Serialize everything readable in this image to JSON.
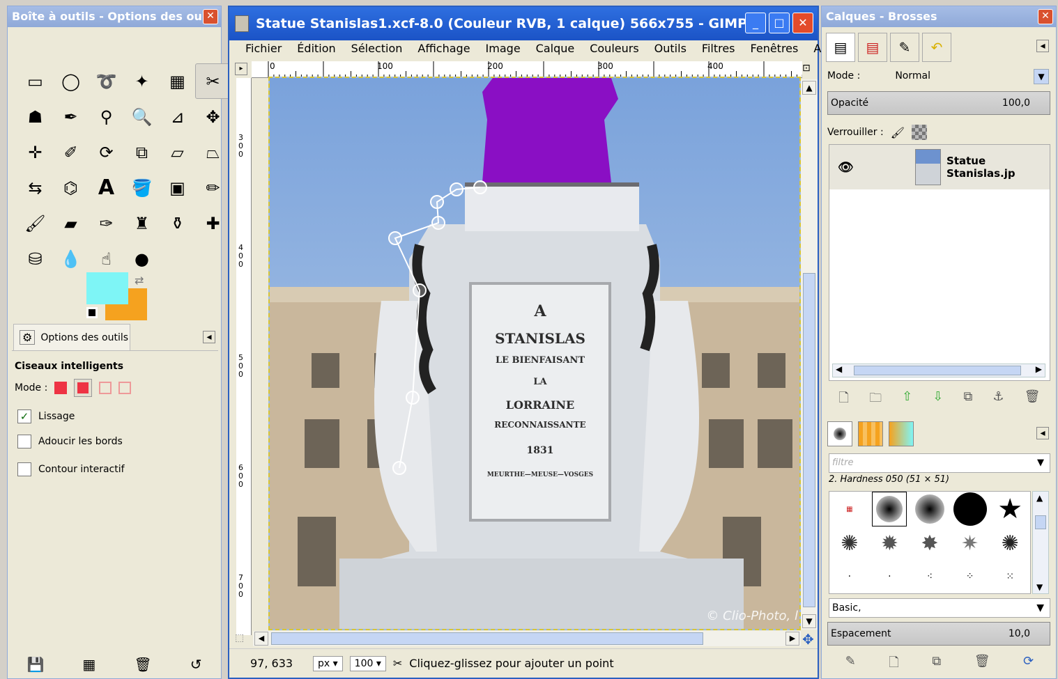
{
  "toolbox": {
    "title": "Boîte à outils - Options des ou...",
    "options_tab": "Options des outils",
    "tool_name": "Ciseaux intelligents",
    "mode_label": "Mode :",
    "options": [
      {
        "label": "Lissage",
        "checked": true
      },
      {
        "label": "Adoucir les bords",
        "checked": false
      },
      {
        "label": "Contour interactif",
        "checked": false
      }
    ],
    "colors": {
      "fg": "#7ef5f6",
      "bg": "#f5a21f"
    }
  },
  "image_window": {
    "title": "Statue Stanislas1.xcf-8.0 (Couleur RVB, 1 calque) 566x755 - GIMP",
    "menus": [
      "Fichier",
      "Édition",
      "Sélection",
      "Affichage",
      "Image",
      "Calque",
      "Couleurs",
      "Outils",
      "Filtres",
      "Fenêtres",
      "Aide"
    ],
    "ruler_h": [
      "0",
      "100",
      "200",
      "300",
      "400"
    ],
    "ruler_v": [
      "300",
      "400",
      "500",
      "600",
      "700"
    ],
    "plaque": [
      "A",
      "STANISLAS",
      "LE BIENFAISANT",
      "LA",
      "LORRAINE",
      "RECONNAISSANTE",
      "1831",
      "MEURTHE—MEUSE—VOSGES"
    ],
    "watermark": "© Clio-Photo, l",
    "status": {
      "coords": "97, 633",
      "unit": "px",
      "zoom": "100",
      "message": "Cliquez-glissez pour ajouter un point"
    }
  },
  "dock": {
    "title": "Calques - Brosses",
    "mode_label": "Mode :",
    "mode_value": "Normal",
    "opacity_label": "Opacité",
    "opacity_value": "100,0",
    "lock_label": "Verrouiller :",
    "layer_name": "Statue Stanislas.jp",
    "filter_placeholder": "filtre",
    "brush_name": "2. Hardness 050 (51 × 51)",
    "brush_set": "Basic,",
    "spacing_label": "Espacement",
    "spacing_value": "10,0"
  }
}
